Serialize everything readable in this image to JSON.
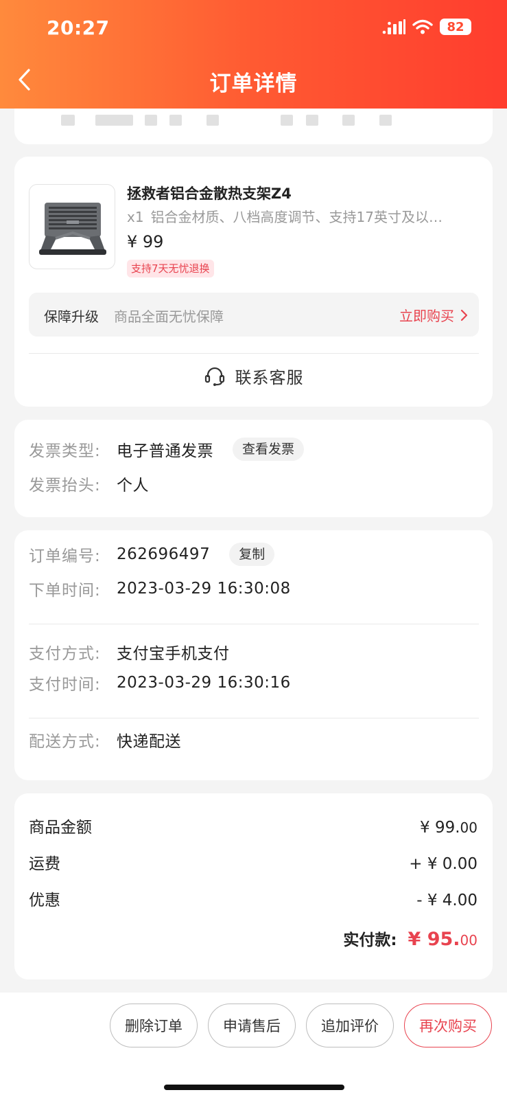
{
  "status_bar": {
    "time": "20:27",
    "battery": "82"
  },
  "header": {
    "title": "订单详情"
  },
  "product": {
    "name": "拯救者铝合金散热支架Z4",
    "qty": "x1",
    "desc": "铝合金材质、八档高度调节、支持17英寸及以…",
    "price": "¥ 99",
    "tag": "支持7天无忧退换",
    "protect": {
      "title": "保障升级",
      "desc": "商品全面无忧保障",
      "buy": "立即购买"
    },
    "service": "联系客服"
  },
  "invoice": {
    "type_label": "发票类型:",
    "type_value": "电子普通发票",
    "view_button": "查看发票",
    "title_label": "发票抬头:",
    "title_value": "个人"
  },
  "order": {
    "no_label": "订单编号:",
    "no_value": "262696497",
    "copy_button": "复制",
    "time_label": "下单时间:",
    "time_value": "2023-03-29 16:30:08",
    "pay_method_label": "支付方式:",
    "pay_method_value": "支付宝手机支付",
    "pay_time_label": "支付时间:",
    "pay_time_value": "2023-03-29 16:30:16",
    "delivery_label": "配送方式:",
    "delivery_value": "快递配送"
  },
  "amounts": {
    "goods_label": "商品金额",
    "goods_value": "¥ 99.",
    "goods_value_small": "00",
    "freight_label": "运费",
    "freight_value": "+ ¥ 0.00",
    "discount_label": "优惠",
    "discount_value": "- ¥ 4.00",
    "paid_label": "实付款:",
    "paid_value": "¥ 95.",
    "paid_value_small": "00"
  },
  "actions": {
    "delete": "删除订单",
    "after_sale": "申请售后",
    "review": "追加评价",
    "rebuy": "再次购买"
  },
  "colors": {
    "accent": "#e8434f",
    "header_start": "#ff8a3c",
    "header_end": "#ff3d2e"
  }
}
